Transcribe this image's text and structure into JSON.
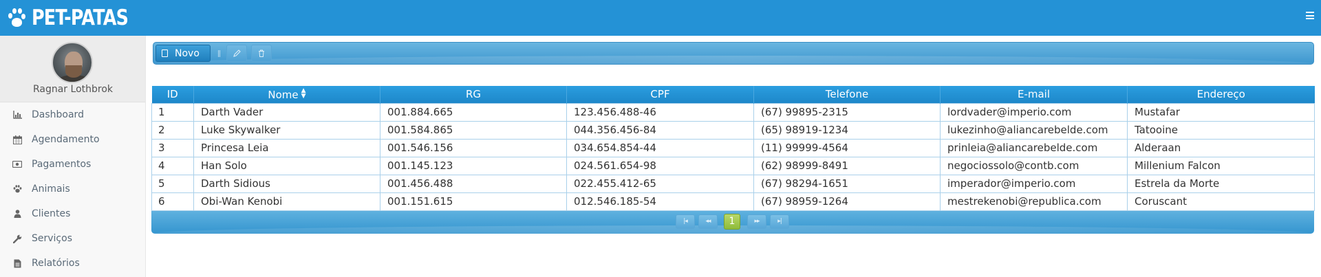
{
  "app": {
    "logo_text": "PET-PATAS",
    "logo_icon": "paw-icon",
    "menu_icon": "hamburger-menu-icon"
  },
  "profile": {
    "name": "Ragnar Lothbrok"
  },
  "sidebar": {
    "items": [
      {
        "label": "Dashboard",
        "icon": "bar-chart-icon"
      },
      {
        "label": "Agendamento",
        "icon": "calendar-icon"
      },
      {
        "label": "Pagamentos",
        "icon": "money-icon"
      },
      {
        "label": "Animais",
        "icon": "paw-icon"
      },
      {
        "label": "Clientes",
        "icon": "user-icon"
      },
      {
        "label": "Serviços",
        "icon": "wrench-icon"
      },
      {
        "label": "Relatórios",
        "icon": "file-icon"
      }
    ]
  },
  "toolbar": {
    "new_label": "Novo",
    "edit_icon": "pencil-icon",
    "delete_icon": "trash-icon"
  },
  "table": {
    "columns": [
      "ID",
      "Nome",
      "RG",
      "CPF",
      "Telefone",
      "E-mail",
      "Endereço"
    ],
    "rows": [
      [
        "1",
        "Darth Vader",
        "001.884.665",
        "123.456.488-46",
        "(67) 99895-2315",
        "lordvader@imperio.com",
        "Mustafar"
      ],
      [
        "2",
        "Luke Skywalker",
        "001.584.865",
        "044.356.456-84",
        "(65) 98919-1234",
        "lukezinho@aliancarebelde.com",
        "Tatooine"
      ],
      [
        "3",
        "Princesa Leia",
        "001.546.156",
        "034.654.854-44",
        "(11) 99999-4564",
        "prinleia@aliancarebelde.com",
        "Alderaan"
      ],
      [
        "4",
        "Han Solo",
        "001.145.123",
        "024.561.654-98",
        "(62) 98999-8491",
        "negociossolo@contb.com",
        "Millenium Falcon"
      ],
      [
        "5",
        "Darth Sidious",
        "001.456.488",
        "022.455.412-65",
        "(67) 98294-1651",
        "imperador@imperio.com",
        "Estrela da Morte"
      ],
      [
        "6",
        "Obi-Wan Kenobi",
        "001.151.615",
        "012.546.185-54",
        "(67) 98959-1264",
        "mestrekenobi@republica.com",
        "Coruscant"
      ]
    ]
  },
  "pager": {
    "first": "|◂",
    "prev": "◂◂",
    "current": "1",
    "next": "▸▸",
    "last": "▸|"
  }
}
